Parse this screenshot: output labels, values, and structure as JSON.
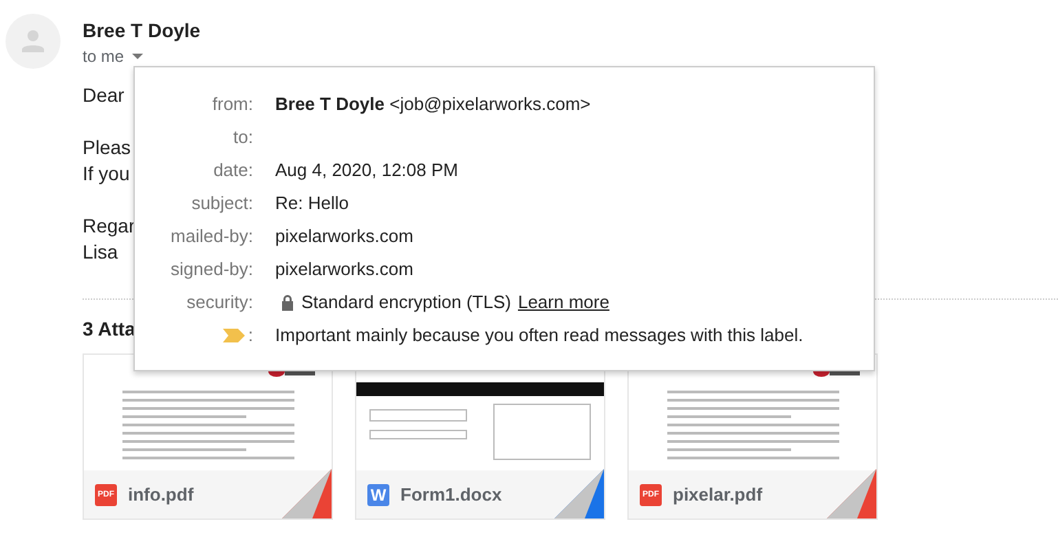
{
  "sender": {
    "name": "Bree T Doyle",
    "recipient": "to me"
  },
  "body_paragraphs": [
    [
      "Dear"
    ],
    [
      "Pleas",
      "If you"
    ],
    [
      "Regar",
      "Lisa"
    ]
  ],
  "attachments_heading": "3 Atta",
  "details_popup": {
    "rows": [
      {
        "kind": "text",
        "label": "from:",
        "name": "Bree T Doyle",
        "value": "<job@pixelarworks.com>"
      },
      {
        "kind": "text",
        "label": "to:"
      },
      {
        "kind": "text",
        "label": "date:",
        "value": "Aug 4, 2020, 12:08 PM"
      },
      {
        "kind": "text",
        "label": "subject:",
        "value": "Re: Hello"
      },
      {
        "kind": "text",
        "label": "mailed-by:",
        "value": "pixelarworks.com"
      },
      {
        "kind": "text",
        "label": "signed-by:",
        "value": "pixelarworks.com"
      },
      {
        "kind": "security",
        "label": "security:",
        "value": "Standard encryption (TLS)",
        "link": "Learn more"
      },
      {
        "kind": "importance",
        "label": ":",
        "value": "Important mainly because you often read messages with this label."
      }
    ]
  },
  "attachments": [
    {
      "name": "info.pdf",
      "type_icon": "PDF",
      "kind": "pdf",
      "color": "#ea4335"
    },
    {
      "name": "Form1.docx",
      "type_icon": "W",
      "kind": "doc",
      "color": "#1a73e8"
    },
    {
      "name": "pixelar.pdf",
      "type_icon": "PDF",
      "kind": "pdf",
      "color": "#ea4335"
    }
  ]
}
